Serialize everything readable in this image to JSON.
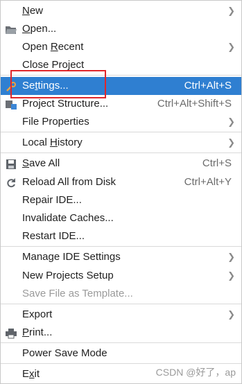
{
  "menu": {
    "new": {
      "pre": "",
      "mn": "N",
      "post": "ew"
    },
    "open": {
      "pre": "",
      "mn": "O",
      "post": "pen..."
    },
    "open_recent": {
      "pre": "Open ",
      "mn": "R",
      "post": "ecent"
    },
    "close_project": {
      "pre": "Close Pro",
      "mn": "j",
      "post": "ect"
    },
    "settings": {
      "pre": "Se",
      "mn": "t",
      "post": "tings...",
      "shortcut": "Ctrl+Alt+S"
    },
    "project_structure": {
      "label": "Project Structure...",
      "shortcut": "Ctrl+Alt+Shift+S"
    },
    "file_properties": {
      "label": "File Properties"
    },
    "local_history": {
      "pre": "Local ",
      "mn": "H",
      "post": "istory"
    },
    "save_all": {
      "pre": "",
      "mn": "S",
      "post": "ave All",
      "shortcut": "Ctrl+S"
    },
    "reload_all": {
      "label": "Reload All from Disk",
      "shortcut": "Ctrl+Alt+Y"
    },
    "repair_ide": {
      "label": "Repair IDE..."
    },
    "invalidate_caches": {
      "label": "Invalidate Caches..."
    },
    "restart_ide": {
      "label": "Restart IDE..."
    },
    "manage_ide_settings": {
      "label": "Manage IDE Settings"
    },
    "new_projects_setup": {
      "label": "New Projects Setup"
    },
    "save_as_template": {
      "label": "Save File as Template..."
    },
    "export": {
      "label": "Export"
    },
    "print": {
      "pre": "",
      "mn": "P",
      "post": "rint..."
    },
    "power_save_mode": {
      "label": "Power Save Mode"
    },
    "exit": {
      "pre": "E",
      "mn": "x",
      "post": "it"
    }
  },
  "watermark": "CSDN @好了，ap",
  "colors": {
    "selection": "#2f7fd1",
    "highlight_box": "#e0262a"
  }
}
